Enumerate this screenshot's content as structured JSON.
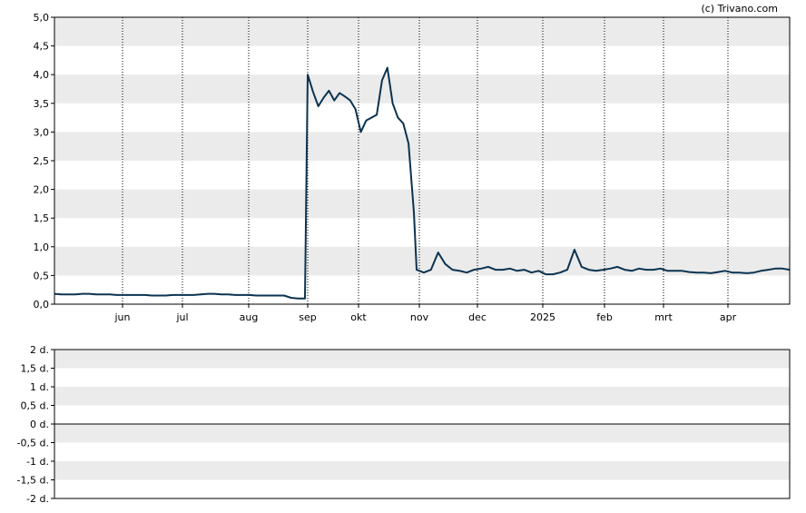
{
  "copyright": "(c) Trivano.com",
  "colors": {
    "line": "#0b3350",
    "band": "#ebebeb",
    "frame": "#000000",
    "grid": "#000000"
  },
  "chart_data": [
    {
      "type": "line",
      "title": "",
      "xlabel": "",
      "ylabel": "",
      "grid": "vertical dotted lines at month ticks; alternating horizontal bands",
      "ylim": [
        0,
        5
      ],
      "y_ticks": [
        "0,0",
        "0,5",
        "1,0",
        "1,5",
        "2,0",
        "2,5",
        "3,0",
        "3,5",
        "4,0",
        "4,5",
        "5,0"
      ],
      "x_ticks": [
        "jun",
        "jul",
        "aug",
        "sep",
        "okt",
        "nov",
        "dec",
        "2025",
        "feb",
        "mrt",
        "apr"
      ],
      "series": [
        {
          "values": [
            0.18,
            0.17,
            0.17,
            0.17,
            0.18,
            0.18,
            0.17,
            0.17,
            0.17,
            0.16,
            0.16,
            0.16,
            0.16,
            0.16,
            0.15,
            0.15,
            0.15,
            0.16,
            0.16,
            0.16,
            0.16,
            0.17,
            0.18,
            0.18,
            0.17,
            0.17,
            0.16,
            0.16,
            0.16,
            0.15,
            0.15,
            0.15,
            0.15,
            0.15,
            0.11,
            0.1,
            0.1,
            4.0,
            3.7,
            3.45,
            3.6,
            3.72,
            3.55,
            3.68,
            3.62,
            3.55,
            3.4,
            3.0,
            3.2,
            3.25,
            3.3,
            3.9,
            4.12,
            3.5,
            3.25,
            3.15,
            2.8,
            1.6,
            0.6,
            0.55,
            0.6,
            0.9,
            0.7,
            0.6,
            0.58,
            0.55,
            0.6,
            0.62,
            0.65,
            0.6,
            0.6,
            0.62,
            0.58,
            0.6,
            0.55,
            0.58,
            0.52,
            0.52,
            0.55,
            0.6,
            0.95,
            0.65,
            0.6,
            0.58,
            0.6,
            0.62,
            0.65,
            0.6,
            0.58,
            0.62,
            0.6,
            0.6,
            0.62,
            0.58,
            0.58,
            0.58,
            0.56,
            0.55,
            0.55,
            0.54,
            0.56,
            0.58,
            0.55,
            0.55,
            0.54,
            0.55,
            0.58,
            0.6,
            0.62,
            0.62,
            0.6
          ]
        }
      ]
    },
    {
      "type": "line",
      "title": "",
      "xlabel": "",
      "ylabel": "",
      "ylim": [
        -2,
        2
      ],
      "y_ticks": [
        "2 d.",
        "1,5 d.",
        "1 d.",
        "0,5 d.",
        "0 d.",
        "-0,5 d.",
        "-1 d.",
        "-1,5 d.",
        "-2 d."
      ],
      "series": []
    }
  ]
}
